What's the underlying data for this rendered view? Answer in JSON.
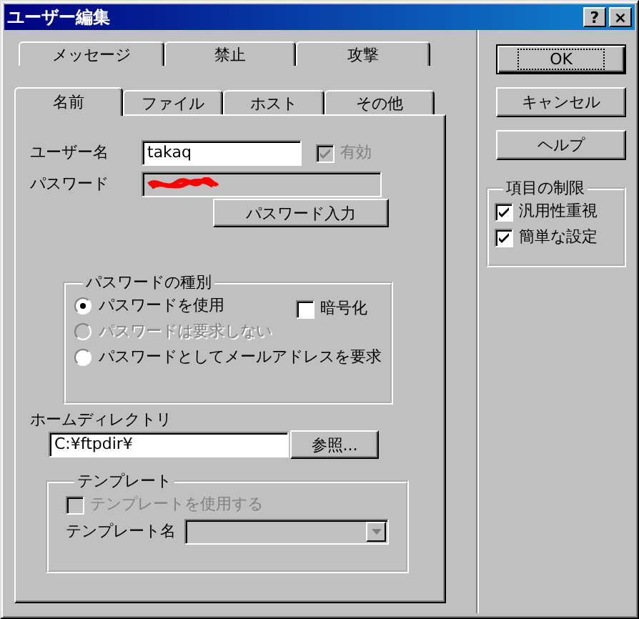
{
  "window": {
    "title": "ユーザー編集",
    "controls": [
      "?",
      "×"
    ]
  },
  "tabs": [
    [
      {
        "label": "メッセージ",
        "selected": false
      },
      {
        "label": "禁止",
        "selected": false
      },
      {
        "label": "攻撃",
        "selected": false
      }
    ],
    [
      {
        "label": "名前",
        "selected": true
      },
      {
        "label": "ファイル",
        "selected": false
      },
      {
        "label": "ホスト",
        "selected": false
      },
      {
        "label": "その他",
        "selected": false
      }
    ]
  ],
  "user_name": {
    "label": "ユーザー名",
    "value": "takaq"
  },
  "enabled": {
    "label": "有効",
    "checked": true,
    "disabled": true
  },
  "password": {
    "label": "パスワード",
    "redacted": true
  },
  "password_button": "パスワード入力",
  "password_type": {
    "title": "パスワードの種別",
    "options": [
      {
        "label": "パスワードを使用",
        "selected": true,
        "disabled": false
      },
      {
        "label": "パスワードは要求しない",
        "selected": false,
        "disabled": true
      },
      {
        "label": "パスワードとしてメールアドレスを要求",
        "selected": false,
        "disabled": false
      }
    ],
    "encrypt": {
      "label": "暗号化",
      "checked": false
    }
  },
  "home_dir": {
    "label": "ホームディレクトリ",
    "value": "C:¥ftpdir¥",
    "browse_button": "参照..."
  },
  "template": {
    "title": "テンプレート",
    "use_template": {
      "label": "テンプレートを使用する",
      "checked": false,
      "disabled": true
    },
    "name": {
      "label": "テンプレート名",
      "disabled": true
    }
  },
  "buttons": [
    {
      "label": "OK",
      "default": true
    },
    {
      "label": "キャンセル",
      "default": false
    },
    {
      "label": "ヘルプ",
      "default": false
    }
  ],
  "restrictions": {
    "title": "項目の制限",
    "items": [
      {
        "label": "汎用性重視",
        "checked": true
      },
      {
        "label": "簡単な設定",
        "checked": true
      }
    ]
  }
}
